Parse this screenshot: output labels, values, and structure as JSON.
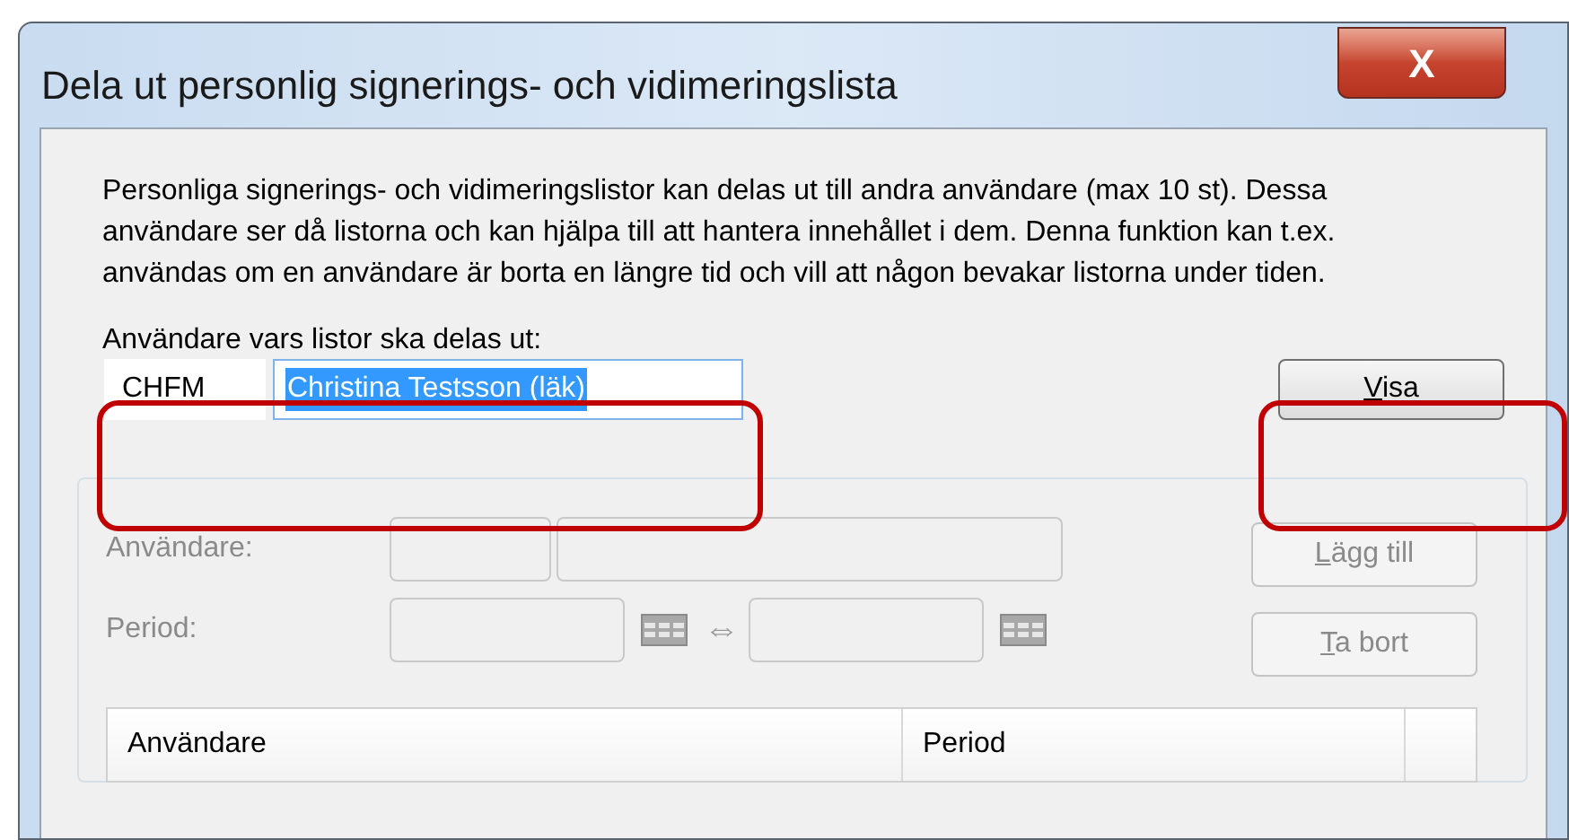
{
  "window": {
    "title": "Dela ut personlig signerings- och vidimeringslista",
    "close": "X"
  },
  "description": "Personliga signerings- och vidimeringslistor kan delas ut till andra användare (max 10 st). Dessa användare ser då listorna och kan hjälpa till att hantera innehållet i dem. Denna funktion kan t.ex. användas om en användare är borta en längre tid och vill att någon bevakar listorna under tiden.",
  "owner": {
    "label": "Användare vars listor ska delas ut:",
    "code": "CHFM",
    "name": "Christina Testsson (läk)",
    "name_selected": true
  },
  "show_button": {
    "label": "Visa",
    "disabled": false
  },
  "share": {
    "disabled": true,
    "user_label": "Användare:",
    "period_label": "Period:",
    "arrow": "⇔",
    "buttons": [
      {
        "label": "Lägg till",
        "disabled": true
      },
      {
        "label": "Ta bort",
        "disabled": true
      }
    ],
    "table": {
      "columns": [
        "Användare",
        "Period"
      ]
    }
  }
}
